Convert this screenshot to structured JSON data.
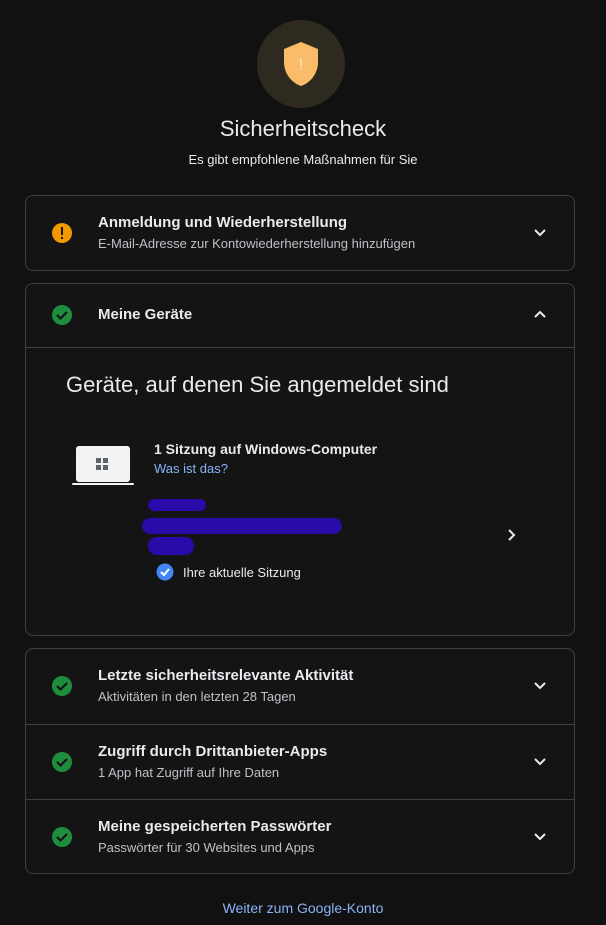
{
  "header": {
    "title": "Sicherheitscheck",
    "subtitle": "Es gibt empfohlene Maßnahmen für Sie",
    "shield_icon": "warning-shield-icon",
    "shield_color": "#fbbc6a"
  },
  "sections": {
    "signin": {
      "title": "Anmeldung und Wiederherstellung",
      "desc": "E-Mail-Adresse zur Kontowiederherstellung hinzufügen",
      "status": "warning",
      "status_color": "#f29900"
    },
    "devices": {
      "title": "Meine Geräte",
      "status": "ok",
      "expanded": true,
      "heading": "Geräte, auf denen Sie angemeldet sind",
      "session_title": "1 Sitzung auf Windows-Computer",
      "session_link": "Was ist das?",
      "current_session": "Ihre aktuelle Sitzung"
    },
    "activity": {
      "title": "Letzte sicherheitsrelevante Aktivität",
      "desc": "Aktivitäten in den letzten 28 Tagen",
      "status": "ok"
    },
    "third_party": {
      "title": "Zugriff durch Drittanbieter-Apps",
      "desc": "1 App hat Zugriff auf Ihre Daten",
      "status": "ok"
    },
    "passwords": {
      "title": "Meine gespeicherten Passwörter",
      "desc": "Passwörter für 30 Websites und Apps",
      "status": "ok"
    }
  },
  "colors": {
    "ok_green": "#1e8e3e",
    "link_blue": "#8ab4f8",
    "check_blue": "#4285f4"
  },
  "footer": {
    "link": "Weiter zum Google-Konto"
  }
}
